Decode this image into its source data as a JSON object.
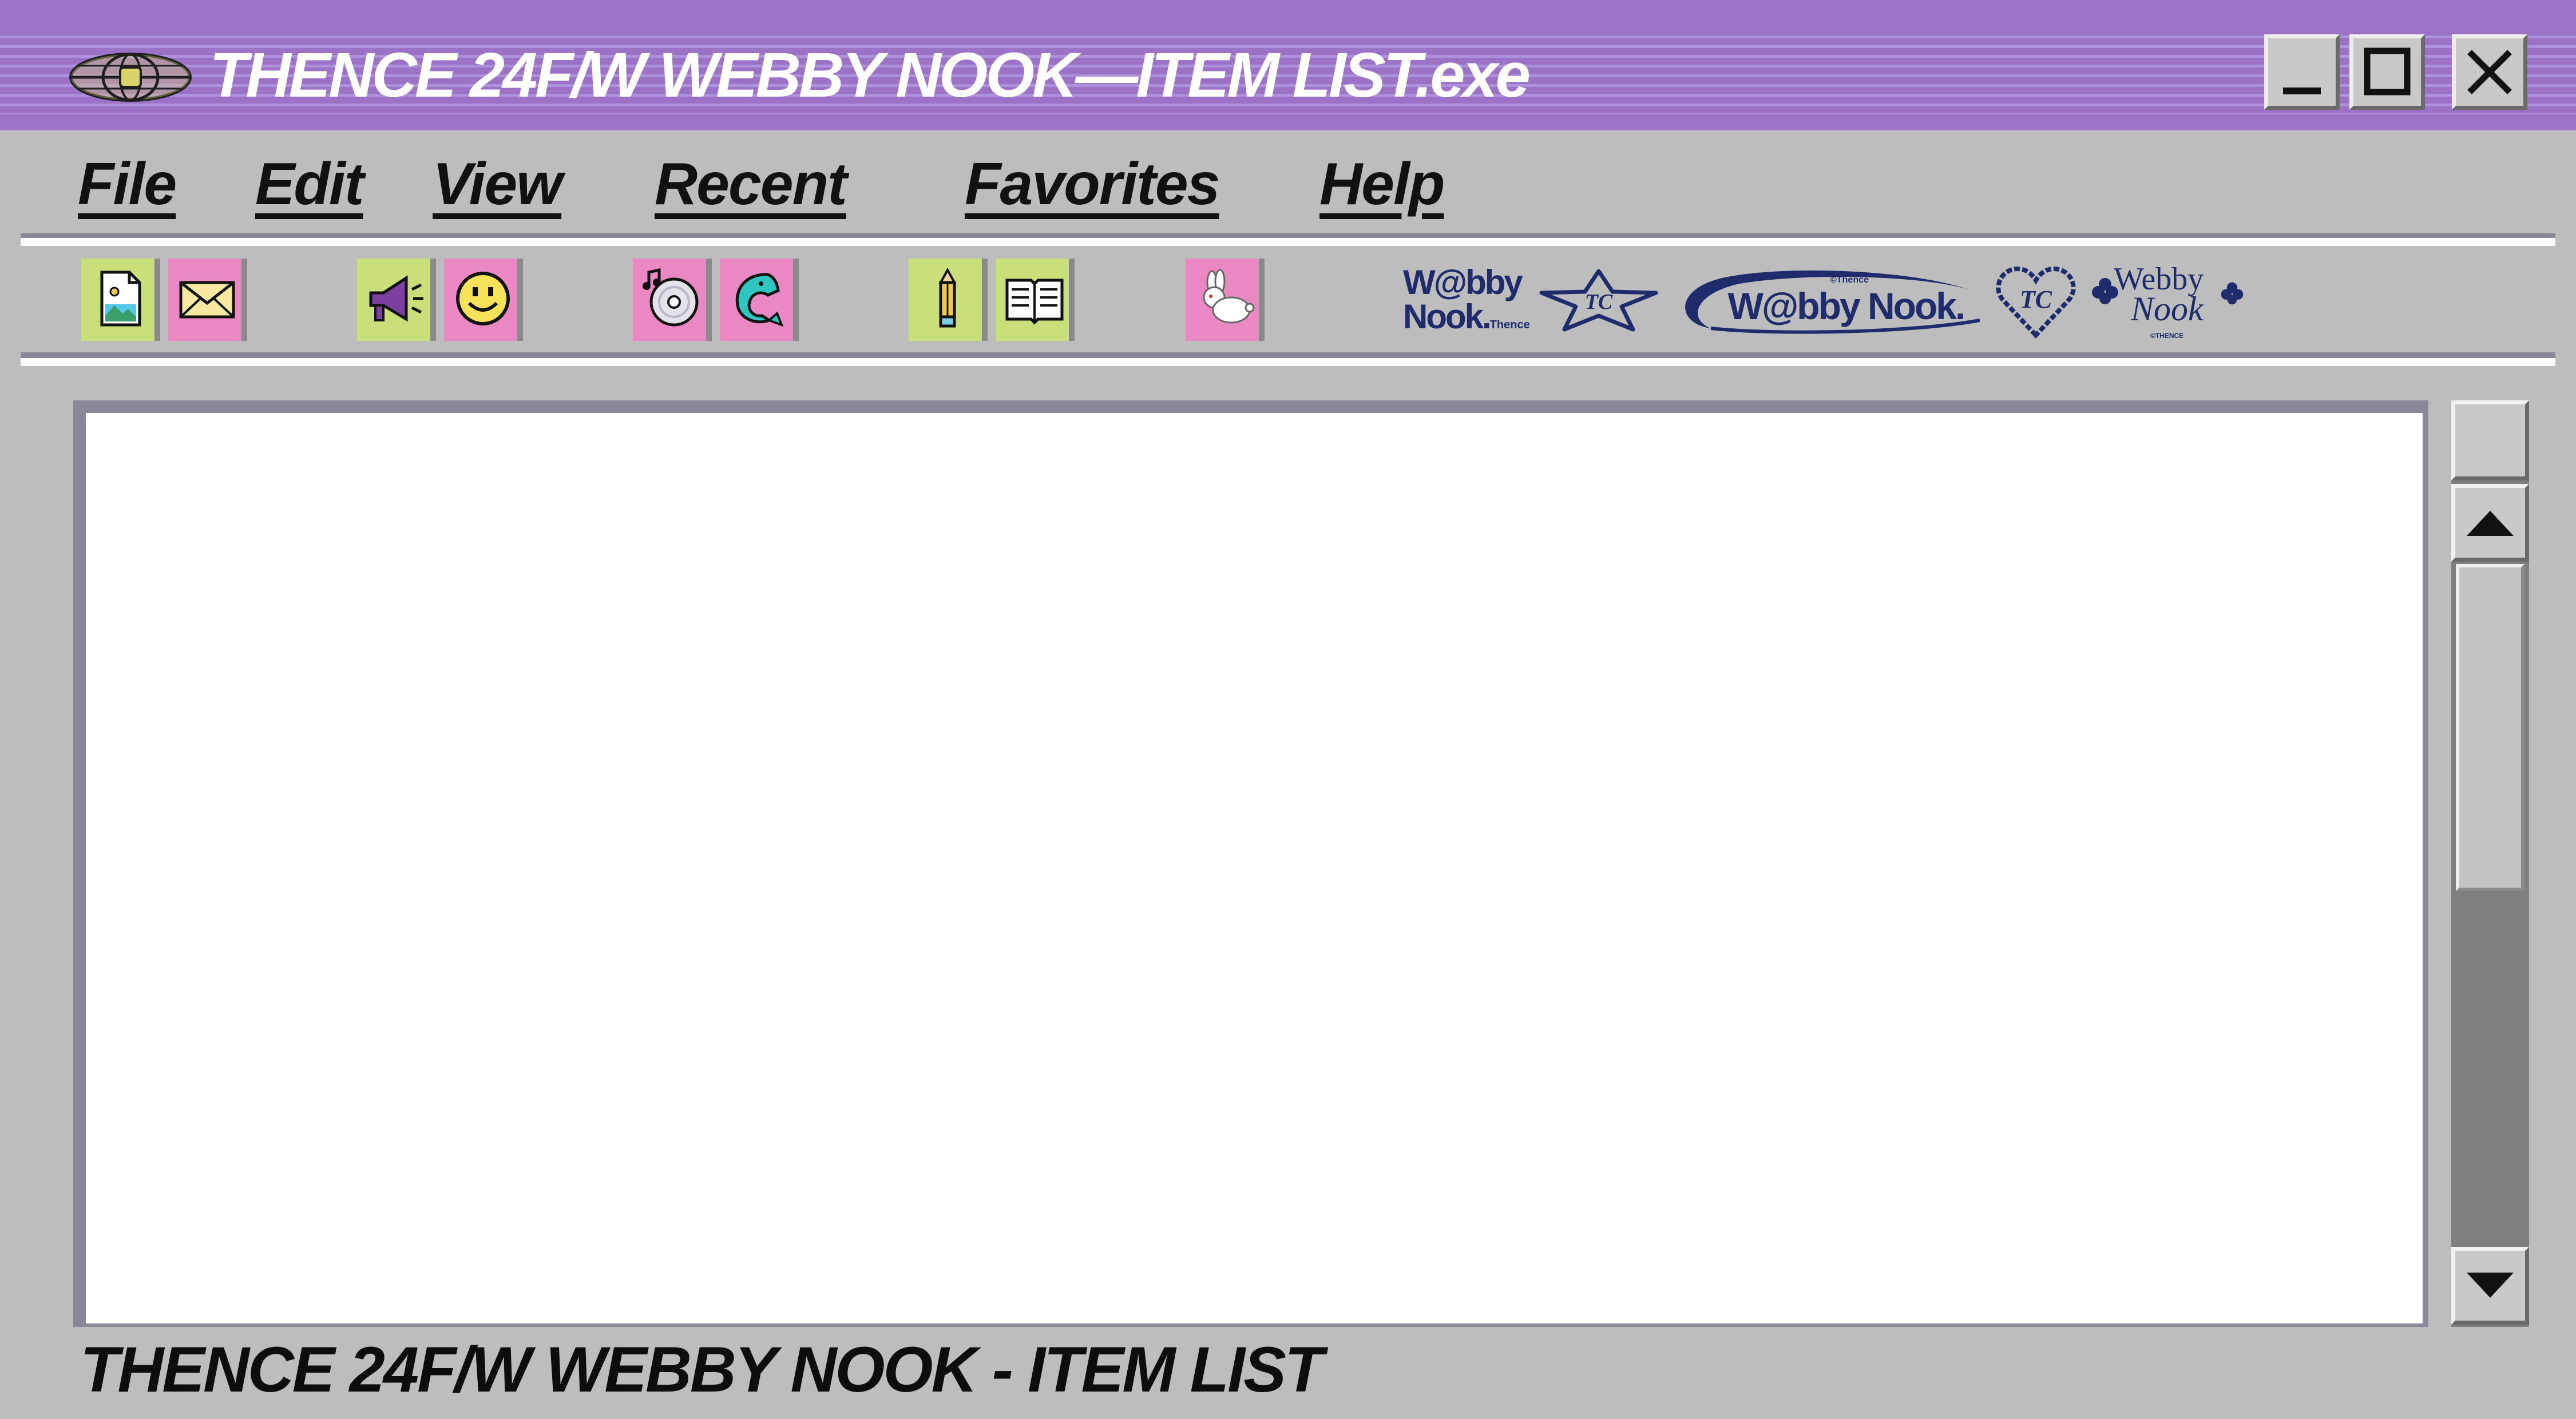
{
  "window": {
    "title": "THENCE 24F/W WEBBY NOOK—ITEM LIST.exe",
    "controls": [
      "minimize",
      "maximize",
      "close"
    ]
  },
  "menu": {
    "items": [
      "File",
      "Edit",
      "View",
      "Recent",
      "Favorites",
      "Help"
    ]
  },
  "toolbar": {
    "icons": [
      {
        "name": "image-file-icon",
        "bg": "#c9e07a"
      },
      {
        "name": "mail-icon",
        "bg": "#ea88c4"
      },
      {
        "name": "megaphone-icon",
        "bg": "#c9e07a"
      },
      {
        "name": "smiley-icon",
        "bg": "#ea88c4"
      },
      {
        "name": "music-cd-icon",
        "bg": "#ea88c4"
      },
      {
        "name": "dolphin-icon",
        "bg": "#ea88c4"
      },
      {
        "name": "pencil-icon",
        "bg": "#c9e07a"
      },
      {
        "name": "open-book-icon",
        "bg": "#c9e07a"
      },
      {
        "name": "rabbit-icon",
        "bg": "#ea88c4"
      }
    ],
    "logos": {
      "logo1_line1": "W@bby",
      "logo1_line2": "Nook.",
      "logo1_small": "Thence",
      "logo2_monogram": "TC",
      "logo3_small": "©Thence",
      "logo3_text": "W@bby Nook.",
      "logo4_monogram": "TC",
      "logo5_line1": "Webby",
      "logo5_line2": "Nook",
      "logo5_small": "©THENCE"
    }
  },
  "content": {
    "body_text": ""
  },
  "status": {
    "text": "THENCE 24F/W WEBBY NOOK - ITEM LIST"
  },
  "colors": {
    "titlebar": "#9b72c6",
    "chrome": "#bdbdbd",
    "icon_green": "#c9e07a",
    "icon_pink": "#ea88c4",
    "logo_navy": "#1f2b6b"
  }
}
